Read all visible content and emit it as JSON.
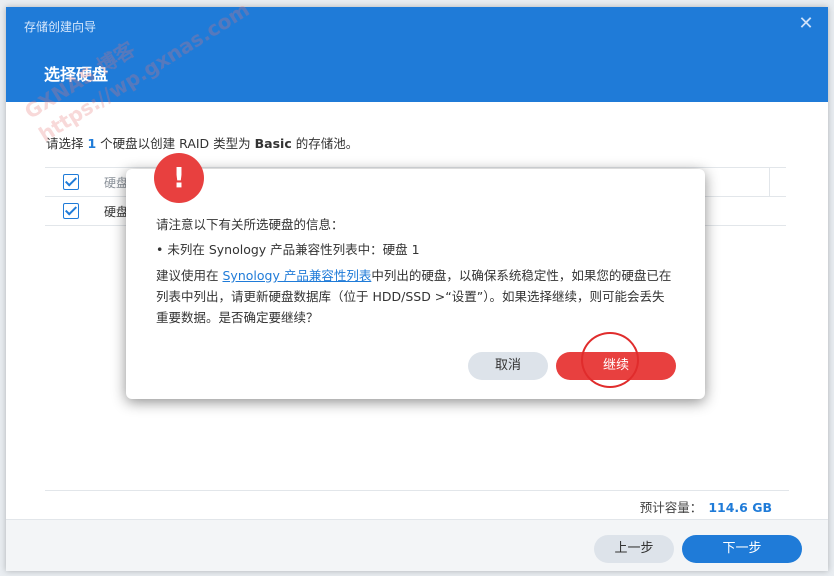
{
  "window": {
    "title": "存储创建向导",
    "close_symbol": "✕"
  },
  "page": {
    "title": "选择硬盘"
  },
  "instruction": {
    "prefix": "请选择 ",
    "count": "1",
    "middle": " 个硬盘以创建 RAID 类型为 ",
    "raid_type": "Basic",
    "suffix": " 的存储池。"
  },
  "disk_table": {
    "header": "硬盘",
    "rows": [
      {
        "label": "硬盘"
      }
    ]
  },
  "footer": {
    "capacity_label": "预计容量：",
    "capacity_value": "114.6 GB",
    "prev_button": "上一步",
    "next_button": "下一步"
  },
  "dialog": {
    "badge": "!",
    "line1": "请注意以下有关所选硬盘的信息：",
    "bullet": "• 未列在 Synology 产品兼容性列表中：硬盘 1",
    "para_prefix": "建议使用在 ",
    "para_link": "Synology 产品兼容性列表",
    "para_suffix": "中列出的硬盘，以确保系统稳定性，如果您的硬盘已在列表中列出，请更新硬盘数据库（位于 HDD/SSD >“设置”）。如果选择继续，则可能会丢失重要数据。是否确定要继续？",
    "cancel_button": "取消",
    "continue_button": "继续"
  },
  "watermark": {
    "line1": "GXNAS 博客",
    "line2": "https://wp.gxnas.com"
  },
  "colors": {
    "header": "#1f7bd8",
    "accent": "#1f7bd8",
    "danger": "#e8403f"
  }
}
